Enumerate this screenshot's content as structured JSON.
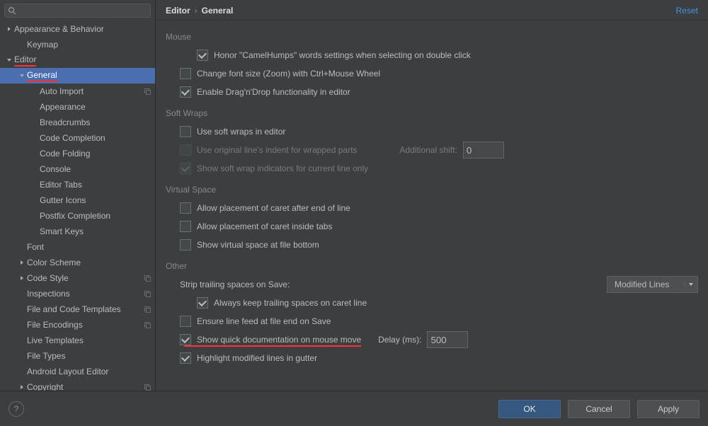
{
  "search": {
    "placeholder": ""
  },
  "sidebar": {
    "items": [
      {
        "label": "Appearance & Behavior",
        "depth": 0,
        "exp": true,
        "arrow": "r",
        "under": false
      },
      {
        "label": "Keymap",
        "depth": 1,
        "arrow": "",
        "under": false
      },
      {
        "label": "Editor",
        "depth": 0,
        "exp": true,
        "arrow": "d",
        "under": true
      },
      {
        "label": "General",
        "depth": 1,
        "exp": true,
        "arrow": "d",
        "sel": true,
        "under": true
      },
      {
        "label": "Auto Import",
        "depth": 2,
        "copy": true
      },
      {
        "label": "Appearance",
        "depth": 2
      },
      {
        "label": "Breadcrumbs",
        "depth": 2
      },
      {
        "label": "Code Completion",
        "depth": 2
      },
      {
        "label": "Code Folding",
        "depth": 2
      },
      {
        "label": "Console",
        "depth": 2
      },
      {
        "label": "Editor Tabs",
        "depth": 2
      },
      {
        "label": "Gutter Icons",
        "depth": 2
      },
      {
        "label": "Postfix Completion",
        "depth": 2
      },
      {
        "label": "Smart Keys",
        "depth": 2
      },
      {
        "label": "Font",
        "depth": 1
      },
      {
        "label": "Color Scheme",
        "depth": 1,
        "arrow": "r"
      },
      {
        "label": "Code Style",
        "depth": 1,
        "arrow": "r",
        "copy": true
      },
      {
        "label": "Inspections",
        "depth": 1,
        "copy": true
      },
      {
        "label": "File and Code Templates",
        "depth": 1,
        "copy": true
      },
      {
        "label": "File Encodings",
        "depth": 1,
        "copy": true
      },
      {
        "label": "Live Templates",
        "depth": 1
      },
      {
        "label": "File Types",
        "depth": 1
      },
      {
        "label": "Android Layout Editor",
        "depth": 1
      },
      {
        "label": "Copyright",
        "depth": 1,
        "arrow": "r",
        "copy": true
      }
    ]
  },
  "breadcrumb": {
    "a": "Editor",
    "b": "General",
    "reset": "Reset"
  },
  "groups": {
    "mouse": {
      "title": "Mouse",
      "items": [
        {
          "label": "Honor \"CamelHumps\" words settings when selecting on double click",
          "on": true,
          "indent": true
        },
        {
          "label": "Change font size (Zoom) with Ctrl+Mouse Wheel",
          "on": false
        },
        {
          "label": "Enable Drag'n'Drop functionality in editor",
          "on": true
        }
      ]
    },
    "softwraps": {
      "title": "Soft Wraps",
      "items": [
        {
          "label": "Use soft wraps in editor",
          "on": false
        },
        {
          "label": "Use original line's indent for wrapped parts",
          "on": false,
          "dis": true,
          "extraLabel": "Additional shift:",
          "extraVal": "0"
        },
        {
          "label": "Show soft wrap indicators for current line only",
          "on": true,
          "dis": true
        }
      ]
    },
    "virtual": {
      "title": "Virtual Space",
      "items": [
        {
          "label": "Allow placement of caret after end of line",
          "on": false
        },
        {
          "label": "Allow placement of caret inside tabs",
          "on": false
        },
        {
          "label": "Show virtual space at file bottom",
          "on": false
        }
      ]
    },
    "other": {
      "title": "Other",
      "strip": {
        "label": "Strip trailing spaces on Save:",
        "value": "Modified Lines"
      },
      "items": [
        {
          "label": "Always keep trailing spaces on caret line",
          "on": true,
          "indent": true
        },
        {
          "label": "Ensure line feed at file end on Save",
          "on": false
        },
        {
          "label": "Show quick documentation on mouse move",
          "on": true,
          "red": true,
          "delayLabel": "Delay (ms):",
          "delayVal": "500"
        },
        {
          "label": "Highlight modified lines in gutter",
          "on": true
        }
      ]
    }
  },
  "buttons": {
    "ok": "OK",
    "cancel": "Cancel",
    "apply": "Apply"
  }
}
